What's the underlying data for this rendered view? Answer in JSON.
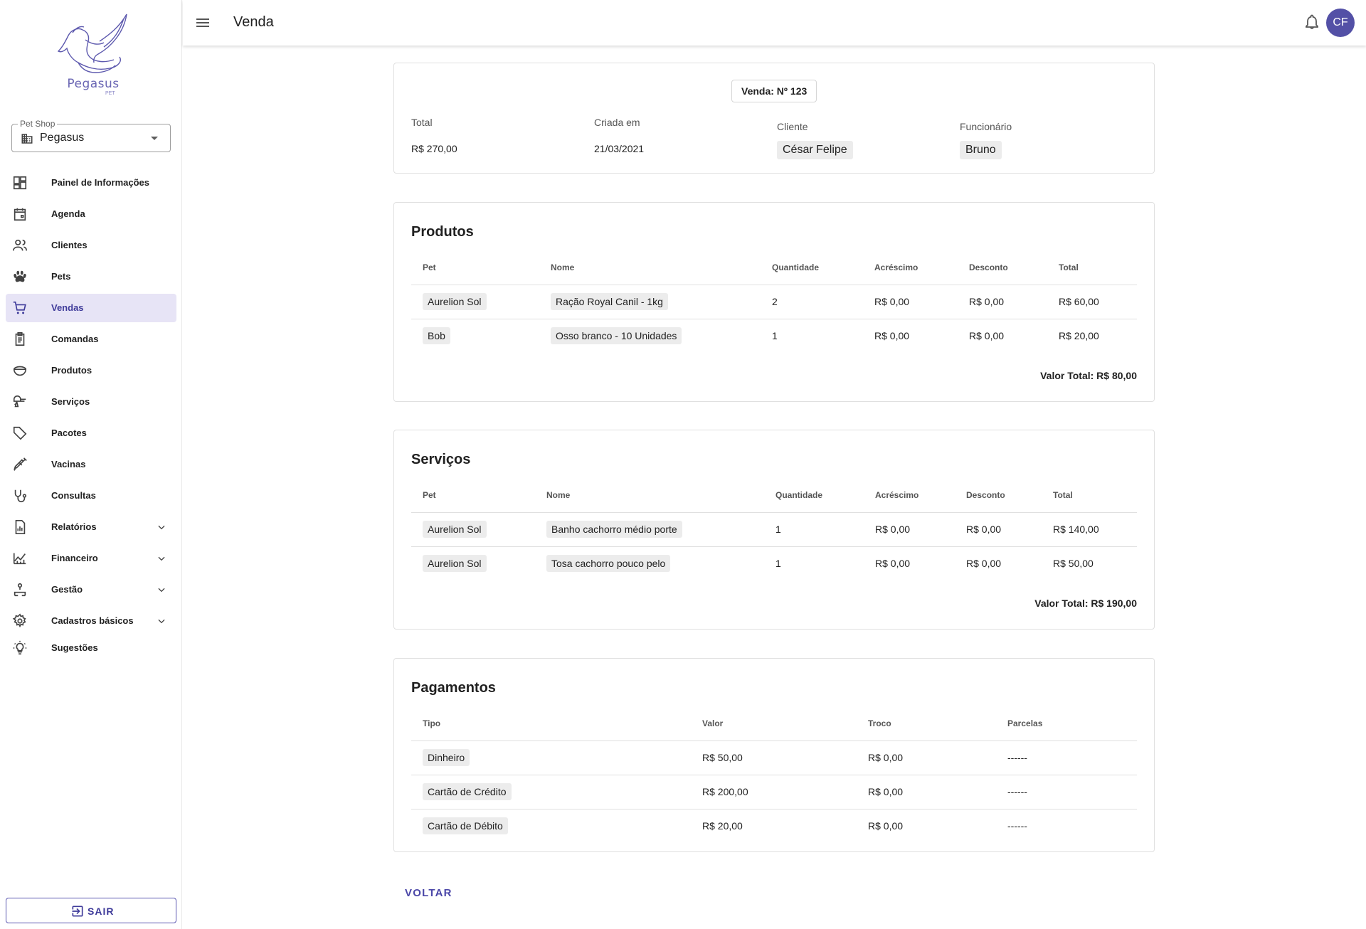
{
  "brand": {
    "name": "Pegasus",
    "sub": "PET"
  },
  "petshop": {
    "legend": "Pet Shop",
    "value": "Pegasus"
  },
  "nav": [
    {
      "label": "Painel de Informações",
      "icon": "dashboard-icon"
    },
    {
      "label": "Agenda",
      "icon": "calendar-icon"
    },
    {
      "label": "Clientes",
      "icon": "people-icon"
    },
    {
      "label": "Pets",
      "icon": "paw-icon"
    },
    {
      "label": "Vendas",
      "icon": "cart-icon",
      "active": true
    },
    {
      "label": "Comandas",
      "icon": "clipboard-icon"
    },
    {
      "label": "Produtos",
      "icon": "bowl-icon"
    },
    {
      "label": "Serviços",
      "icon": "dryer-icon"
    },
    {
      "label": "Pacotes",
      "icon": "tags-icon"
    },
    {
      "label": "Vacinas",
      "icon": "syringe-icon"
    },
    {
      "label": "Consultas",
      "icon": "stethoscope-icon"
    },
    {
      "label": "Relatórios",
      "icon": "report-icon",
      "expandable": true
    },
    {
      "label": "Financeiro",
      "icon": "chart-icon",
      "expandable": true
    },
    {
      "label": "Gestão",
      "icon": "hierarchy-icon",
      "expandable": true
    },
    {
      "label": "Cadastros básicos",
      "icon": "gear-icon",
      "expandable": true
    },
    {
      "label": "Sugestões",
      "icon": "lightbulb-icon"
    }
  ],
  "logout": {
    "label": "SAIR"
  },
  "topbar": {
    "title": "Venda",
    "avatar": "CF"
  },
  "sale": {
    "badge": "Venda: Nº 123",
    "total_label": "Total",
    "total_value": "R$ 270,00",
    "created_label": "Criada em",
    "created_value": "21/03/2021",
    "client_label": "Cliente",
    "client_value": "César Felipe",
    "employee_label": "Funcionário",
    "employee_value": "Bruno"
  },
  "products": {
    "title": "Produtos",
    "headers": [
      "Pet",
      "Nome",
      "Quantidade",
      "Acréscimo",
      "Desconto",
      "Total"
    ],
    "rows": [
      [
        "Aurelion Sol",
        "Ração Royal Canil - 1kg",
        "2",
        "R$ 0,00",
        "R$ 0,00",
        "R$ 60,00"
      ],
      [
        "Bob",
        "Osso branco - 10 Unidades",
        "1",
        "R$ 0,00",
        "R$ 0,00",
        "R$ 20,00"
      ]
    ],
    "total": "Valor Total: R$ 80,00"
  },
  "services": {
    "title": "Serviços",
    "headers": [
      "Pet",
      "Nome",
      "Quantidade",
      "Acréscimo",
      "Desconto",
      "Total"
    ],
    "rows": [
      [
        "Aurelion Sol",
        "Banho cachorro médio porte",
        "1",
        "R$ 0,00",
        "R$ 0,00",
        "R$ 140,00"
      ],
      [
        "Aurelion Sol",
        "Tosa cachorro pouco pelo",
        "1",
        "R$ 0,00",
        "R$ 0,00",
        "R$ 50,00"
      ]
    ],
    "total": "Valor Total: R$ 190,00"
  },
  "payments": {
    "title": "Pagamentos",
    "headers": [
      "Tipo",
      "Valor",
      "Troco",
      "Parcelas"
    ],
    "rows": [
      [
        "Dinheiro",
        "R$ 50,00",
        "R$ 0,00",
        "------"
      ],
      [
        "Cartão de Crédito",
        "R$ 200,00",
        "R$ 0,00",
        "------"
      ],
      [
        "Cartão de Débito",
        "R$ 20,00",
        "R$ 0,00",
        "------"
      ]
    ]
  },
  "back": {
    "label": "VOLTAR"
  },
  "colors": {
    "accent": "#4b47a8",
    "active_bg": "#e7e4f6",
    "avatar_bg": "#5350a6"
  }
}
